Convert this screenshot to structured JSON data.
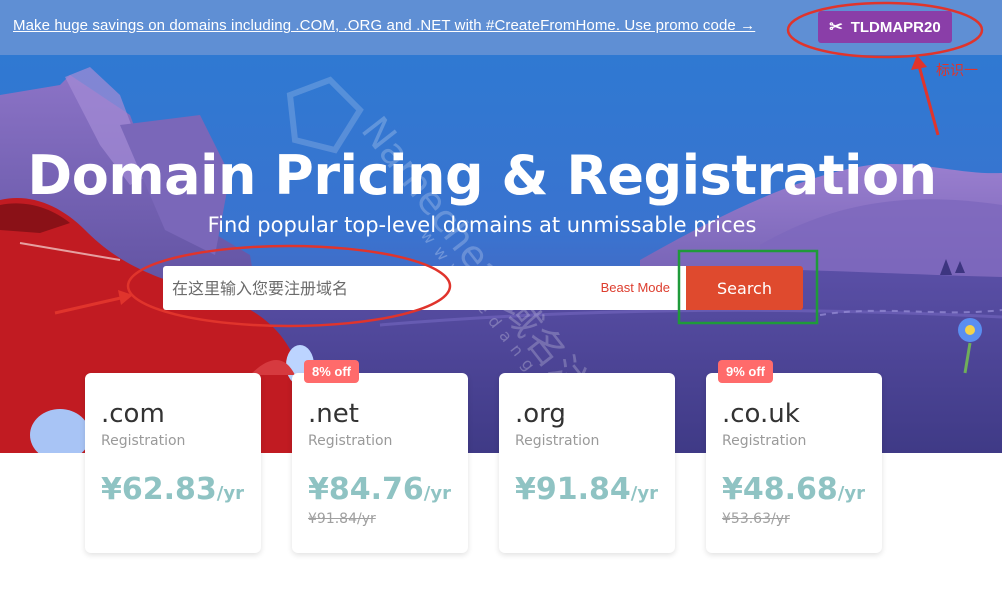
{
  "promo": {
    "text": "Make huge savings on domains including .COM, .ORG and .NET with #CreateFromHome. Use promo code →",
    "code": "TLDMAPR20",
    "code_icon": "scissors-icon"
  },
  "hero": {
    "title": "Domain Pricing & Registration",
    "subtitle": "Find popular top-level domains at unmissable prices"
  },
  "search": {
    "placeholder": "在这里输入您要注册域名",
    "beast_mode_label": "Beast Mode",
    "button_label": "Search"
  },
  "cards": [
    {
      "tld": ".com",
      "label": "Registration",
      "price": "¥62.83",
      "per": "/yr",
      "old_price": "",
      "badge": ""
    },
    {
      "tld": ".net",
      "label": "Registration",
      "price": "¥84.76",
      "per": "/yr",
      "old_price": "¥91.84/yr",
      "badge": "8% off"
    },
    {
      "tld": ".org",
      "label": "Registration",
      "price": "¥91.84",
      "per": "/yr",
      "old_price": "",
      "badge": ""
    },
    {
      "tld": ".co.uk",
      "label": "Registration",
      "price": "¥48.68",
      "per": "/yr",
      "old_price": "¥53.63/yr",
      "badge": "9% off"
    }
  ],
  "annotation": {
    "label": "标识一"
  },
  "watermark": {
    "text": "Namecheap域名注册指南",
    "sub": "www.kedang.com"
  },
  "colors": {
    "promo_bg": "#5f8fd4",
    "promo_code_bg": "#8a3ea8",
    "search_button": "#df4a2e",
    "beast_mode": "#dd3d2e",
    "price": "#8fc3c3",
    "badge": "#ff6b6b",
    "annotation_red": "#e0342c",
    "annotation_green": "#1f9a3a"
  }
}
